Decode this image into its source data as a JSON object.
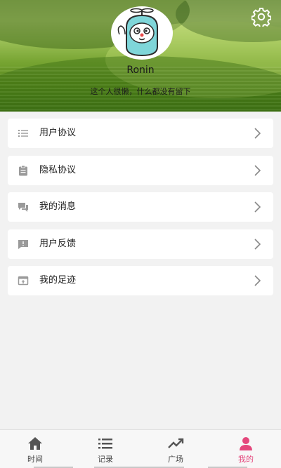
{
  "profile": {
    "username": "Ronin",
    "signature": "这个人很懒，什么都没有留下"
  },
  "header": {
    "settings_icon": "gear-icon"
  },
  "menu": {
    "items": [
      {
        "label": "用户协议",
        "icon": "list-icon"
      },
      {
        "label": "隐私协议",
        "icon": "clipboard-icon"
      },
      {
        "label": "我的消息",
        "icon": "chat-bubbles-icon"
      },
      {
        "label": "用户反馈",
        "icon": "feedback-icon"
      },
      {
        "label": "我的足迹",
        "icon": "footprint-box-icon"
      }
    ]
  },
  "tabbar": {
    "tabs": [
      {
        "label": "时间",
        "icon": "home-icon",
        "active": false
      },
      {
        "label": "记录",
        "icon": "list-icon",
        "active": false
      },
      {
        "label": "广场",
        "icon": "trending-up-icon",
        "active": false
      },
      {
        "label": "我的",
        "icon": "person-icon",
        "active": true
      }
    ],
    "active_color": "#e4477c",
    "inactive_color": "#444444"
  }
}
